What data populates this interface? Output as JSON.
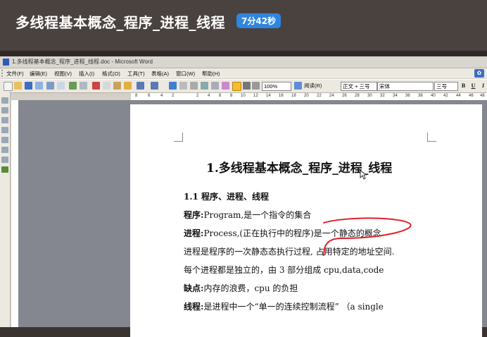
{
  "video": {
    "title": "多线程基本概念_程序_进程_线程",
    "duration": "7分42秒"
  },
  "window": {
    "title": "1.多线程基本概念_程序_进程_线程.doc - Microsoft Word"
  },
  "menu": [
    "文件(F)",
    "编辑(E)",
    "视图(V)",
    "插入(I)",
    "格式(O)",
    "工具(T)",
    "表格(A)",
    "窗口(W)",
    "帮助(H)"
  ],
  "toolbar": {
    "zoom": "100%",
    "read_label": "阅读(R)",
    "style": "正文 + 三号",
    "font": "宋体",
    "size": "三号",
    "bold": "B",
    "underline": "U",
    "italic": "I"
  },
  "ruler": [
    "8",
    "6",
    "4",
    "2",
    "2",
    "4",
    "6",
    "8",
    "10",
    "12",
    "14",
    "16",
    "18",
    "20",
    "22",
    "24",
    "26",
    "28",
    "30",
    "32",
    "34",
    "36",
    "38",
    "40",
    "42",
    "44",
    "46",
    "48"
  ],
  "document": {
    "heading": "1.多线程基本概念_程序_进程_线程",
    "section": "1.1 程序、进程、线程",
    "lines": [
      {
        "term": "程序:",
        "text": "Program,是一个指令的集合"
      },
      {
        "term": "进程:",
        "text": "Process,(正在执行中的程序)是一个静态的概念"
      },
      {
        "term": "",
        "text": "进程是程序的一次静态态执行过程, 占用特定的地址空间."
      },
      {
        "term": "",
        "text": "每个进程都是独立的，由 3 部分组成 cpu,data,code"
      },
      {
        "term": "缺点:",
        "text": "内存的浪费，cpu 的负担"
      },
      {
        "term": "线程:",
        "text": "是进程中一个“单一的连续控制流程”  （a single"
      }
    ]
  },
  "colors": {
    "header_bg": "#4a423f",
    "badge": "#2f86e0",
    "annotation": "#e0202a"
  }
}
